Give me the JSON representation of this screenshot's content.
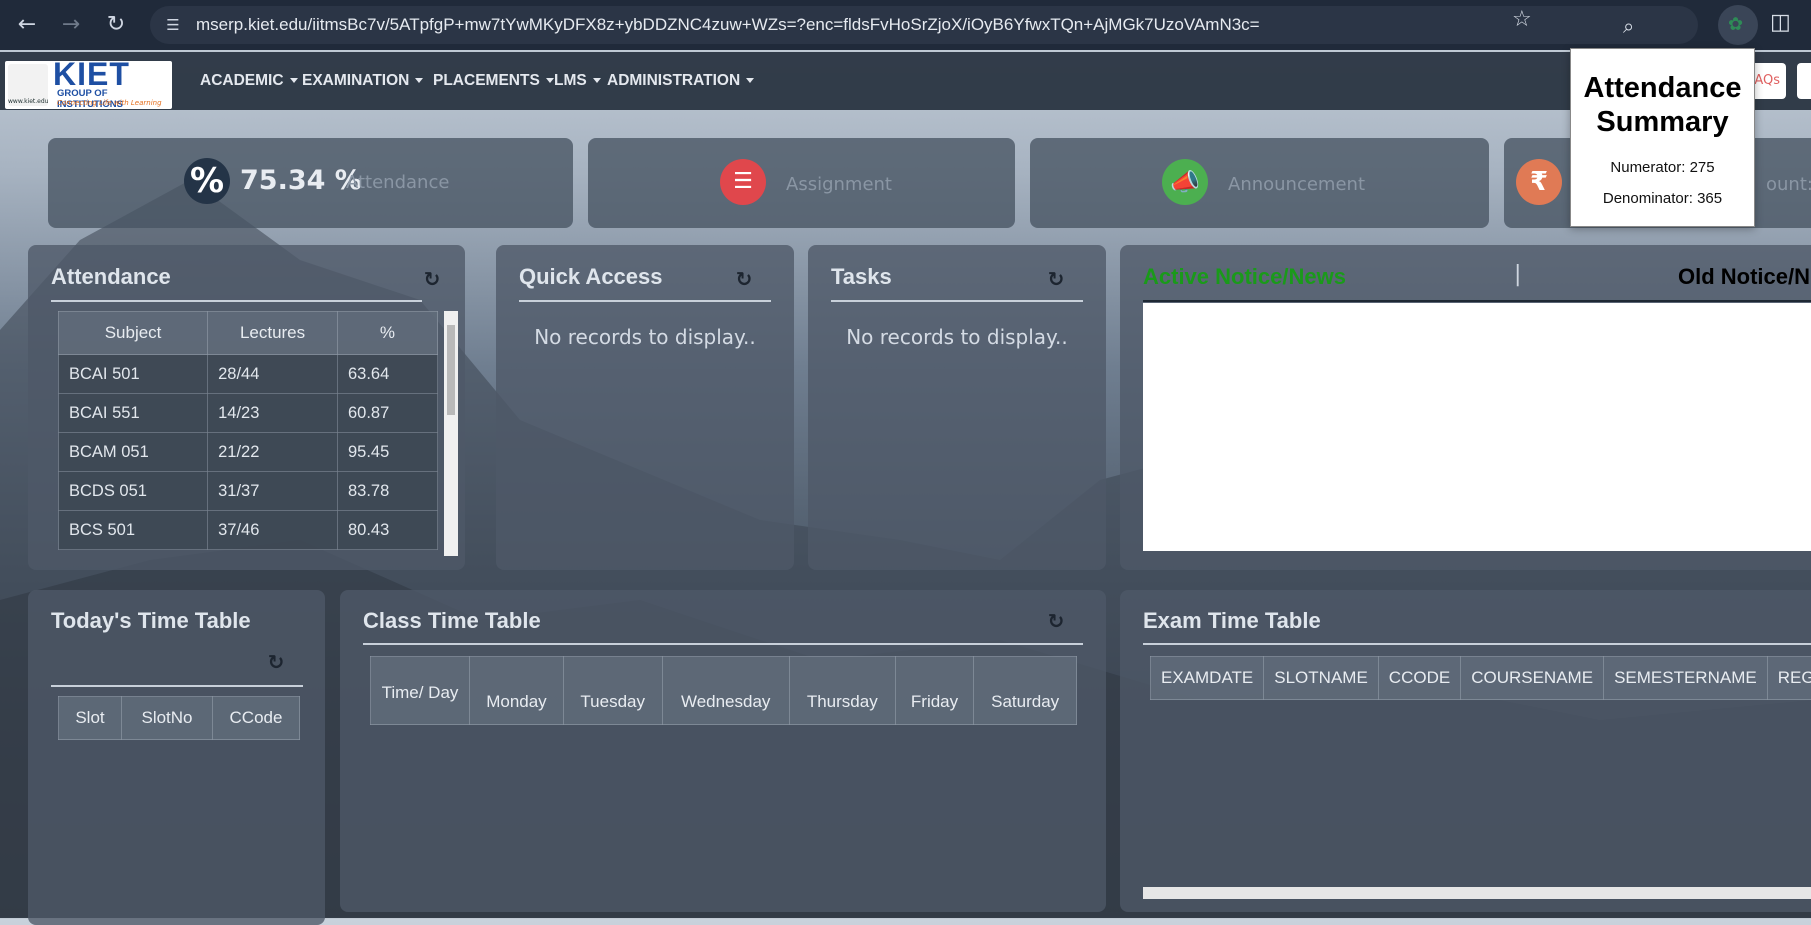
{
  "browser": {
    "url": "mserp.kiet.edu/iitmsBc7v/5ATpfgP+mw7tYwMKyDFX8z+ybDDZNC4zuw+WZs=?enc=fldsFvHoSrZjoX/iOyB6YfwxTQn+AjMGk7UzoVAmN3c="
  },
  "logo": {
    "name": "KIET",
    "group": "GROUP OF INSTITUTIONS",
    "tagline": "Connecting Life with Learning",
    "seal_text": "www.kiet.edu"
  },
  "menu": [
    "ACADEMIC",
    "EXAMINATION",
    "PLACEMENTS",
    "LMS",
    "ADMINISTRATION"
  ],
  "header_right": {
    "faq_label": "AQs"
  },
  "popup": {
    "title": "Attendance Summary",
    "numerator": "Numerator: 275",
    "denominator": "Denominator: 365"
  },
  "stats": {
    "attendance_value": "75.34 %",
    "attendance_label": "Attendance",
    "assignment_label": "Assignment",
    "announcement_label": "Announcement",
    "fee_label": "ount: "
  },
  "attendance_panel": {
    "title": "Attendance",
    "columns": [
      "Subject",
      "Lectures",
      "%"
    ],
    "rows": [
      [
        "BCAI 501",
        "28/44",
        "63.64"
      ],
      [
        "BCAI 551",
        "14/23",
        "60.87"
      ],
      [
        "BCAM 051",
        "21/22",
        "95.45"
      ],
      [
        "BCDS 051",
        "31/37",
        "83.78"
      ],
      [
        "BCS 501",
        "37/46",
        "80.43"
      ]
    ]
  },
  "quick_access": {
    "title": "Quick Access",
    "empty": "No records to display.."
  },
  "tasks": {
    "title": "Tasks",
    "empty": "No records to display.."
  },
  "notices": {
    "active_tab": "Active Notice/News",
    "separator": "|",
    "old_tab": "Old Notice/N"
  },
  "today_tt": {
    "title": "Today's Time Table",
    "columns": [
      "Slot",
      "SlotNo",
      "CCode"
    ]
  },
  "class_tt": {
    "title": "Class Time Table",
    "columns": [
      "Time/ Day",
      "Monday",
      "Tuesday",
      "Wednesday",
      "Thursday",
      "Friday",
      "Saturday"
    ]
  },
  "exam_tt": {
    "title": "Exam Time Table",
    "columns": [
      "EXAMDATE",
      "SLOTNAME",
      "CCODE",
      "COURSENAME",
      "SEMESTERNAME",
      "REGULAR_E"
    ]
  },
  "colors": {
    "attendance_icon": "#243447",
    "assignment_icon": "#e0474c",
    "announcement_icon": "#4caf50",
    "fee_icon": "#e07a55",
    "active_notice": "#1a9a1a"
  }
}
